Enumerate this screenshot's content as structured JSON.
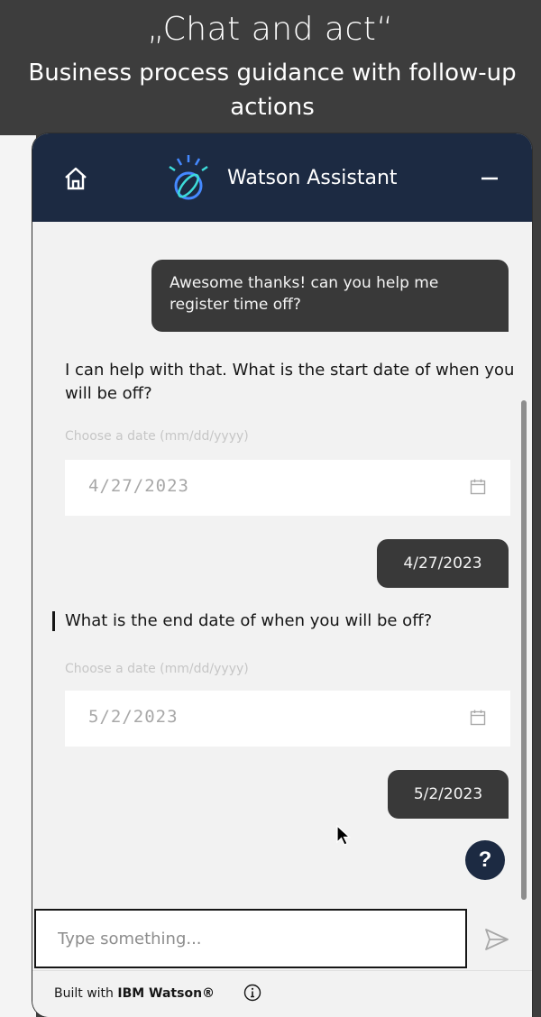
{
  "slide": {
    "title": "„Chat and act“",
    "subtitle": "Business process guidance with follow-up actions"
  },
  "header": {
    "title": "Watson Assistant",
    "home_icon": "home-icon",
    "logo_icon": "watson-logo-icon",
    "minimize_icon": "minimize-icon"
  },
  "messages": {
    "user_1": "Awesome thanks! can you help me register time off?",
    "bot_1": "I can help with that. What is the start date of when you will be off?",
    "date_hint_1": "Choose a date (mm/dd/yyyy)",
    "date_value_1": "4/27/2023",
    "user_2": "4/27/2023",
    "bot_2": "What is the end date of when you will be off?",
    "date_hint_2": "Choose a date (mm/dd/yyyy)",
    "date_value_2": "5/2/2023",
    "user_3": "5/2/2023"
  },
  "help_button": {
    "label": "?"
  },
  "input": {
    "placeholder": "Type something..."
  },
  "footer": {
    "prefix": "Built with ",
    "brand": "IBM Watson®"
  },
  "colors": {
    "header_bg": "#1c2a42",
    "user_bubble": "#393939",
    "body_bg": "#f2f2f2",
    "page_bg": "#3d3d3d"
  }
}
